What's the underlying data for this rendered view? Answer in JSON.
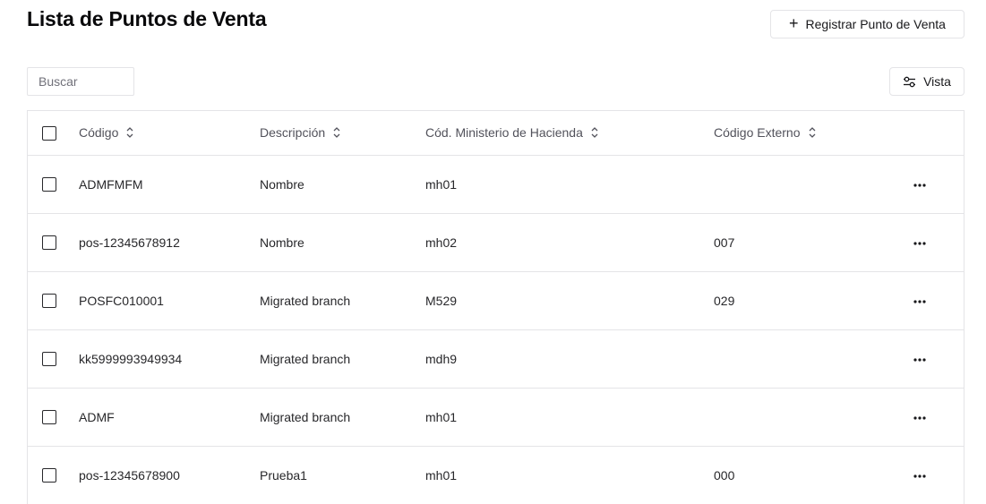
{
  "header": {
    "title": "Lista de Puntos de Venta",
    "register_label": "Registrar Punto de Venta",
    "register_icon": "plus-icon"
  },
  "toolbar": {
    "search_placeholder": "Buscar",
    "search_value": "",
    "view_label": "Vista",
    "view_icon": "sliders-icon"
  },
  "table": {
    "columns": [
      "Código",
      "Descripción",
      "Cód. Ministerio de Hacienda",
      "Código Externo"
    ],
    "rows": [
      {
        "code": "ADMFMFM",
        "description": "Nombre",
        "mh_code": "mh01",
        "external_code": ""
      },
      {
        "code": "pos-12345678912",
        "description": "Nombre",
        "mh_code": "mh02",
        "external_code": "007"
      },
      {
        "code": "POSFC010001",
        "description": "Migrated branch",
        "mh_code": "M529",
        "external_code": "029"
      },
      {
        "code": "kk5999993949934",
        "description": "Migrated branch",
        "mh_code": "mdh9",
        "external_code": ""
      },
      {
        "code": "ADMF",
        "description": "Migrated branch",
        "mh_code": "mh01",
        "external_code": ""
      },
      {
        "code": "pos-12345678900",
        "description": "Prueba1",
        "mh_code": "mh01",
        "external_code": "000"
      }
    ]
  },
  "colors": {
    "border": "#e4e4e7",
    "text": "#27272a",
    "header_text": "#52525b"
  }
}
